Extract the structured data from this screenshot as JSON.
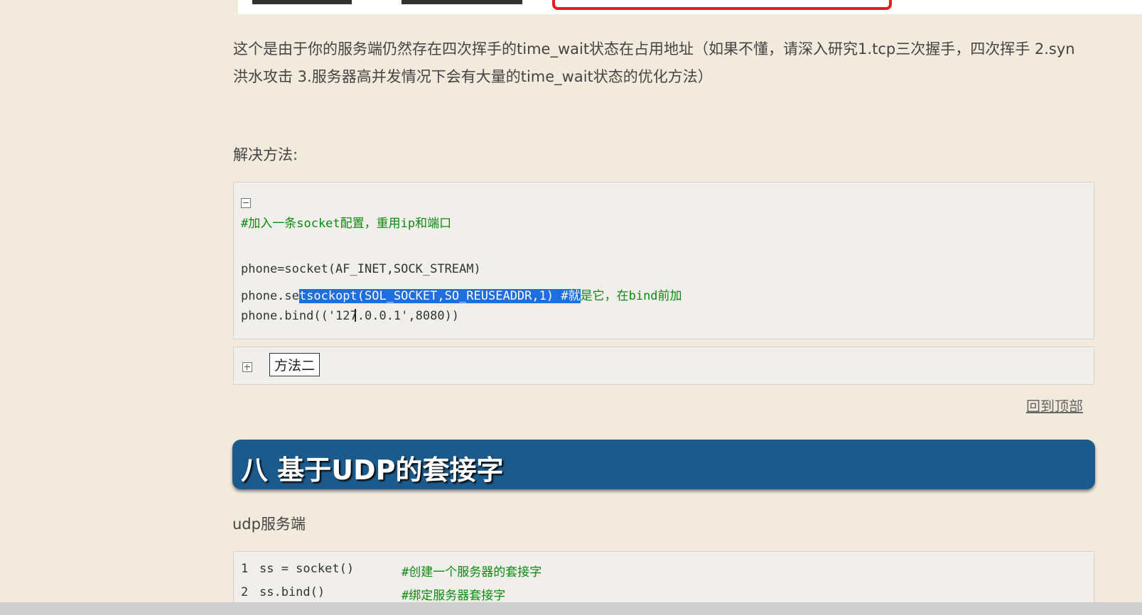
{
  "paragraph": "这个是由于你的服务端仍然存在四次挥手的time_wait状态在占用地址（如果不懂，请深入研究1.tcp三次握手，四次挥手 2.syn洪水攻击 3.服务器高并发情况下会有大量的time_wait状态的优化方法）",
  "solution_label": "解决方法:",
  "code_block_1": {
    "comment": "#加入一条socket配置，重用ip和端口",
    "line_socket": "phone=socket(AF_INET,SOCK_STREAM)",
    "line_setsockopt_before": "phone.se",
    "line_setsockopt_selected": "tsockopt(SOL_SOCKET,SO_REUSEADDR,1) #就",
    "line_setsockopt_after": "是它，在bind前加",
    "line_bind": "phone.bind(('127.0.0.1',8080))"
  },
  "method2_label": "方法二",
  "back_to_top": "回到顶部",
  "section_title": "八 基于UDP的套接字",
  "udp_server_label": "udp服务端",
  "code_block_2": [
    {
      "num": "1",
      "code": "ss = socket()",
      "comment": "#创建一个服务器的套接字"
    },
    {
      "num": "2",
      "code": "ss.bind()",
      "comment": "#绑定服务器套接字"
    }
  ],
  "colors": {
    "page_bg": "#f2eadd",
    "banner_bg": "#1b5a8c",
    "selection": "#1f6ee0",
    "comment": "#0b8a0b",
    "highlight_box": "#e41e1e"
  }
}
